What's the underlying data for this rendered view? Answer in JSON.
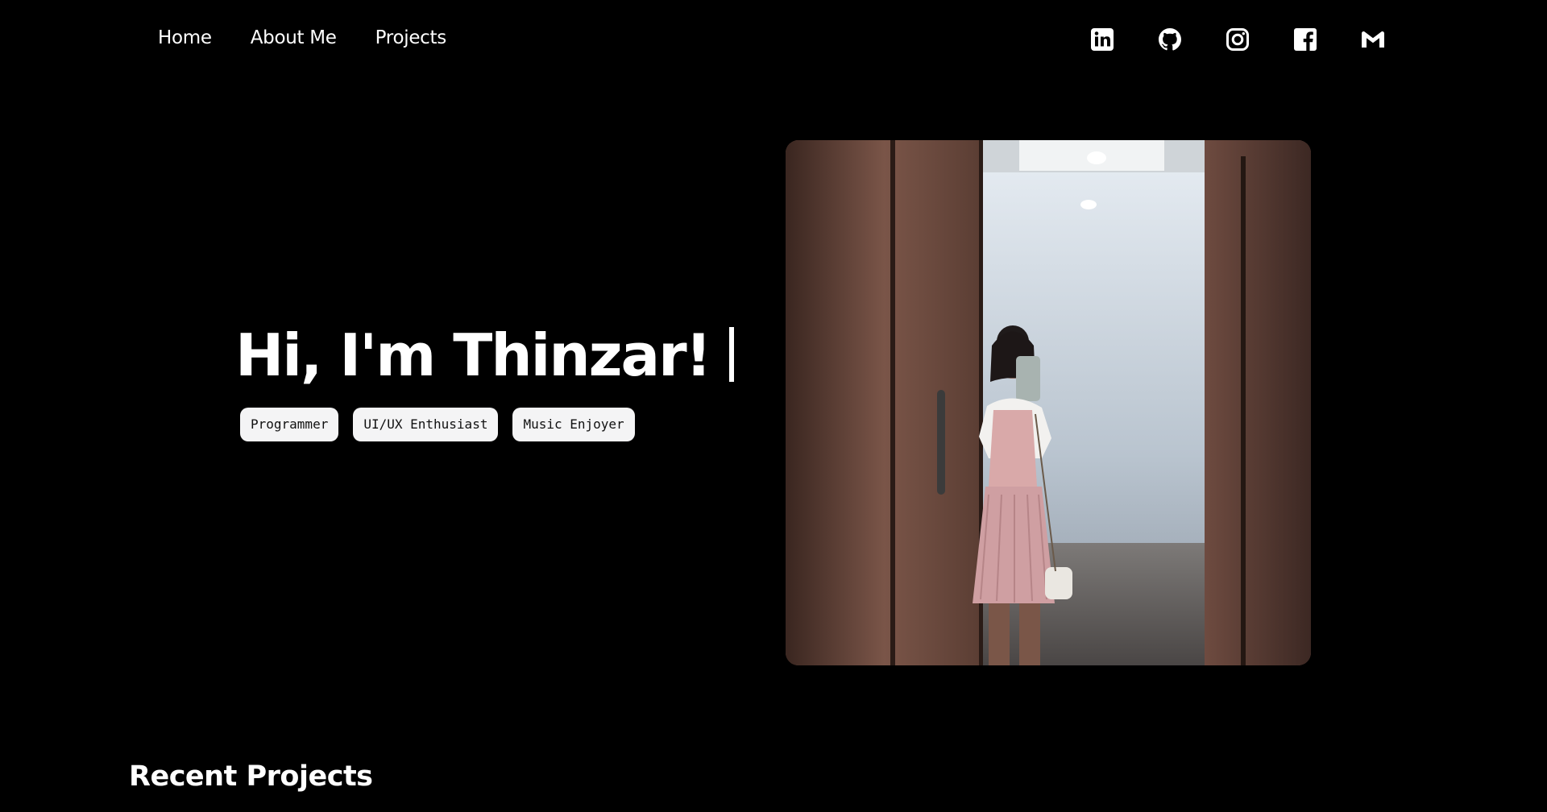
{
  "nav": {
    "items": [
      {
        "label": "Home"
      },
      {
        "label": "About Me"
      },
      {
        "label": "Projects"
      }
    ]
  },
  "socials": [
    {
      "icon": "linkedin-icon"
    },
    {
      "icon": "github-icon"
    },
    {
      "icon": "instagram-icon"
    },
    {
      "icon": "facebook-icon"
    },
    {
      "icon": "gmail-icon"
    }
  ],
  "hero": {
    "title": "Hi, I'm Thinzar!",
    "tags": [
      "Programmer",
      "UI/UX Enthusiast",
      "Music Enjoyer"
    ]
  },
  "sections": {
    "recent_projects_title": "Recent Projects"
  },
  "colors": {
    "background": "#000000",
    "text": "#ffffff",
    "tag_bg": "#f4f4f5",
    "tag_text": "#111111"
  }
}
